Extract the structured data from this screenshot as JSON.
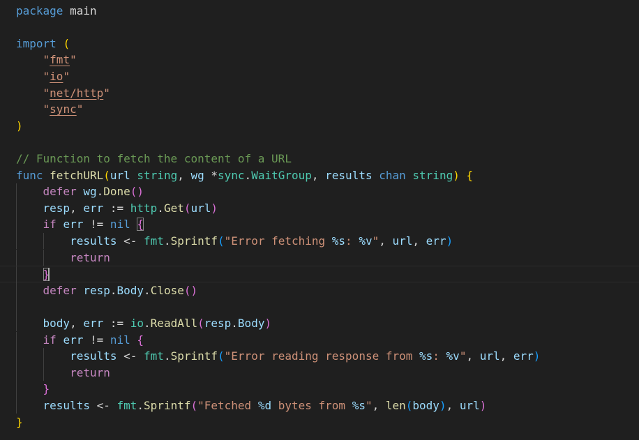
{
  "editor": {
    "language": "go",
    "lines": [
      {
        "tokens": [
          [
            "kw-blue",
            "package"
          ],
          [
            "plain",
            " main"
          ]
        ]
      },
      {
        "tokens": []
      },
      {
        "tokens": [
          [
            "kw-blue",
            "import"
          ],
          [
            "plain",
            " "
          ],
          [
            "br1",
            "("
          ]
        ]
      },
      {
        "tokens": [
          [
            "plain",
            "    "
          ],
          [
            "str",
            "\""
          ],
          [
            "str u",
            "fmt"
          ],
          [
            "str",
            "\""
          ]
        ]
      },
      {
        "tokens": [
          [
            "plain",
            "    "
          ],
          [
            "str",
            "\""
          ],
          [
            "str u",
            "io"
          ],
          [
            "str",
            "\""
          ]
        ]
      },
      {
        "tokens": [
          [
            "plain",
            "    "
          ],
          [
            "str",
            "\""
          ],
          [
            "str u",
            "net/http"
          ],
          [
            "str",
            "\""
          ]
        ]
      },
      {
        "tokens": [
          [
            "plain",
            "    "
          ],
          [
            "str",
            "\""
          ],
          [
            "str u",
            "sync"
          ],
          [
            "str",
            "\""
          ]
        ]
      },
      {
        "tokens": [
          [
            "br1",
            ")"
          ]
        ]
      },
      {
        "tokens": []
      },
      {
        "tokens": [
          [
            "cmt",
            "// Function to fetch the content of a URL"
          ]
        ]
      },
      {
        "tokens": [
          [
            "kw-blue",
            "func"
          ],
          [
            "plain",
            " "
          ],
          [
            "fn",
            "fetchURL"
          ],
          [
            "br1",
            "("
          ],
          [
            "var",
            "url"
          ],
          [
            "plain",
            " "
          ],
          [
            "type",
            "string"
          ],
          [
            "plain",
            ", "
          ],
          [
            "var",
            "wg"
          ],
          [
            "plain",
            " *"
          ],
          [
            "type",
            "sync"
          ],
          [
            "plain",
            "."
          ],
          [
            "type",
            "WaitGroup"
          ],
          [
            "plain",
            ", "
          ],
          [
            "var",
            "results"
          ],
          [
            "plain",
            " "
          ],
          [
            "kw-blue",
            "chan"
          ],
          [
            "plain",
            " "
          ],
          [
            "type",
            "string"
          ],
          [
            "br1",
            ")"
          ],
          [
            "plain",
            " "
          ],
          [
            "br1",
            "{"
          ]
        ]
      },
      {
        "tokens": [
          [
            "plain",
            "    "
          ],
          [
            "kw-purple",
            "defer"
          ],
          [
            "plain",
            " "
          ],
          [
            "var",
            "wg"
          ],
          [
            "plain",
            "."
          ],
          [
            "fn",
            "Done"
          ],
          [
            "br2",
            "()"
          ]
        ]
      },
      {
        "tokens": [
          [
            "plain",
            "    "
          ],
          [
            "var",
            "resp"
          ],
          [
            "plain",
            ", "
          ],
          [
            "var",
            "err"
          ],
          [
            "plain",
            " := "
          ],
          [
            "type",
            "http"
          ],
          [
            "plain",
            "."
          ],
          [
            "fn",
            "Get"
          ],
          [
            "br2",
            "("
          ],
          [
            "var",
            "url"
          ],
          [
            "br2",
            ")"
          ]
        ]
      },
      {
        "tokens": [
          [
            "plain",
            "    "
          ],
          [
            "kw-purple",
            "if"
          ],
          [
            "plain",
            " "
          ],
          [
            "var",
            "err"
          ],
          [
            "plain",
            " != "
          ],
          [
            "kw-blue",
            "nil"
          ],
          [
            "plain",
            " "
          ],
          [
            "br2 box",
            "{"
          ]
        ]
      },
      {
        "tokens": [
          [
            "plain",
            "        "
          ],
          [
            "var",
            "results"
          ],
          [
            "plain",
            " <- "
          ],
          [
            "type",
            "fmt"
          ],
          [
            "plain",
            "."
          ],
          [
            "fn",
            "Sprintf"
          ],
          [
            "br3",
            "("
          ],
          [
            "str",
            "\"Error fetching "
          ],
          [
            "esc",
            "%s"
          ],
          [
            "str",
            ": "
          ],
          [
            "esc",
            "%v"
          ],
          [
            "str",
            "\""
          ],
          [
            "plain",
            ", "
          ],
          [
            "var",
            "url"
          ],
          [
            "plain",
            ", "
          ],
          [
            "var",
            "err"
          ],
          [
            "br3",
            ")"
          ]
        ]
      },
      {
        "tokens": [
          [
            "plain",
            "        "
          ],
          [
            "kw-purple",
            "return"
          ]
        ]
      },
      {
        "tokens": [
          [
            "plain",
            "    "
          ],
          [
            "br2 box",
            "}"
          ]
        ]
      },
      {
        "tokens": [
          [
            "plain",
            "    "
          ],
          [
            "kw-purple",
            "defer"
          ],
          [
            "plain",
            " "
          ],
          [
            "var",
            "resp"
          ],
          [
            "plain",
            "."
          ],
          [
            "var",
            "Body"
          ],
          [
            "plain",
            "."
          ],
          [
            "fn",
            "Close"
          ],
          [
            "br2",
            "()"
          ]
        ]
      },
      {
        "tokens": []
      },
      {
        "tokens": [
          [
            "plain",
            "    "
          ],
          [
            "var",
            "body"
          ],
          [
            "plain",
            ", "
          ],
          [
            "var",
            "err"
          ],
          [
            "plain",
            " := "
          ],
          [
            "type",
            "io"
          ],
          [
            "plain",
            "."
          ],
          [
            "fn",
            "ReadAll"
          ],
          [
            "br2",
            "("
          ],
          [
            "var",
            "resp"
          ],
          [
            "plain",
            "."
          ],
          [
            "var",
            "Body"
          ],
          [
            "br2",
            ")"
          ]
        ]
      },
      {
        "tokens": [
          [
            "plain",
            "    "
          ],
          [
            "kw-purple",
            "if"
          ],
          [
            "plain",
            " "
          ],
          [
            "var",
            "err"
          ],
          [
            "plain",
            " != "
          ],
          [
            "kw-blue",
            "nil"
          ],
          [
            "plain",
            " "
          ],
          [
            "br2",
            "{"
          ]
        ]
      },
      {
        "tokens": [
          [
            "plain",
            "        "
          ],
          [
            "var",
            "results"
          ],
          [
            "plain",
            " <- "
          ],
          [
            "type",
            "fmt"
          ],
          [
            "plain",
            "."
          ],
          [
            "fn",
            "Sprintf"
          ],
          [
            "br3",
            "("
          ],
          [
            "str",
            "\"Error reading response from "
          ],
          [
            "esc",
            "%s"
          ],
          [
            "str",
            ": "
          ],
          [
            "esc",
            "%v"
          ],
          [
            "str",
            "\""
          ],
          [
            "plain",
            ", "
          ],
          [
            "var",
            "url"
          ],
          [
            "plain",
            ", "
          ],
          [
            "var",
            "err"
          ],
          [
            "br3",
            ")"
          ]
        ]
      },
      {
        "tokens": [
          [
            "plain",
            "        "
          ],
          [
            "kw-purple",
            "return"
          ]
        ]
      },
      {
        "tokens": [
          [
            "plain",
            "    "
          ],
          [
            "br2",
            "}"
          ]
        ]
      },
      {
        "tokens": [
          [
            "plain",
            "    "
          ],
          [
            "var",
            "results"
          ],
          [
            "plain",
            " <- "
          ],
          [
            "type",
            "fmt"
          ],
          [
            "plain",
            "."
          ],
          [
            "fn",
            "Sprintf"
          ],
          [
            "br2",
            "("
          ],
          [
            "str",
            "\"Fetched "
          ],
          [
            "esc",
            "%d"
          ],
          [
            "str",
            " bytes from "
          ],
          [
            "esc",
            "%s"
          ],
          [
            "str",
            "\""
          ],
          [
            "plain",
            ", "
          ],
          [
            "fn",
            "len"
          ],
          [
            "br3",
            "("
          ],
          [
            "var",
            "body"
          ],
          [
            "br3",
            ")"
          ],
          [
            "plain",
            ", "
          ],
          [
            "var",
            "url"
          ],
          [
            "br2",
            ")"
          ]
        ]
      },
      {
        "tokens": [
          [
            "br1",
            "}"
          ]
        ]
      }
    ]
  },
  "colors": {
    "background": "#1f1f1f",
    "keyword": "#569cd6",
    "control": "#c586c0",
    "function": "#dcdcaa",
    "type": "#4ec9b0",
    "variable": "#9cdcfe",
    "string": "#ce9178",
    "comment": "#6a9955"
  }
}
